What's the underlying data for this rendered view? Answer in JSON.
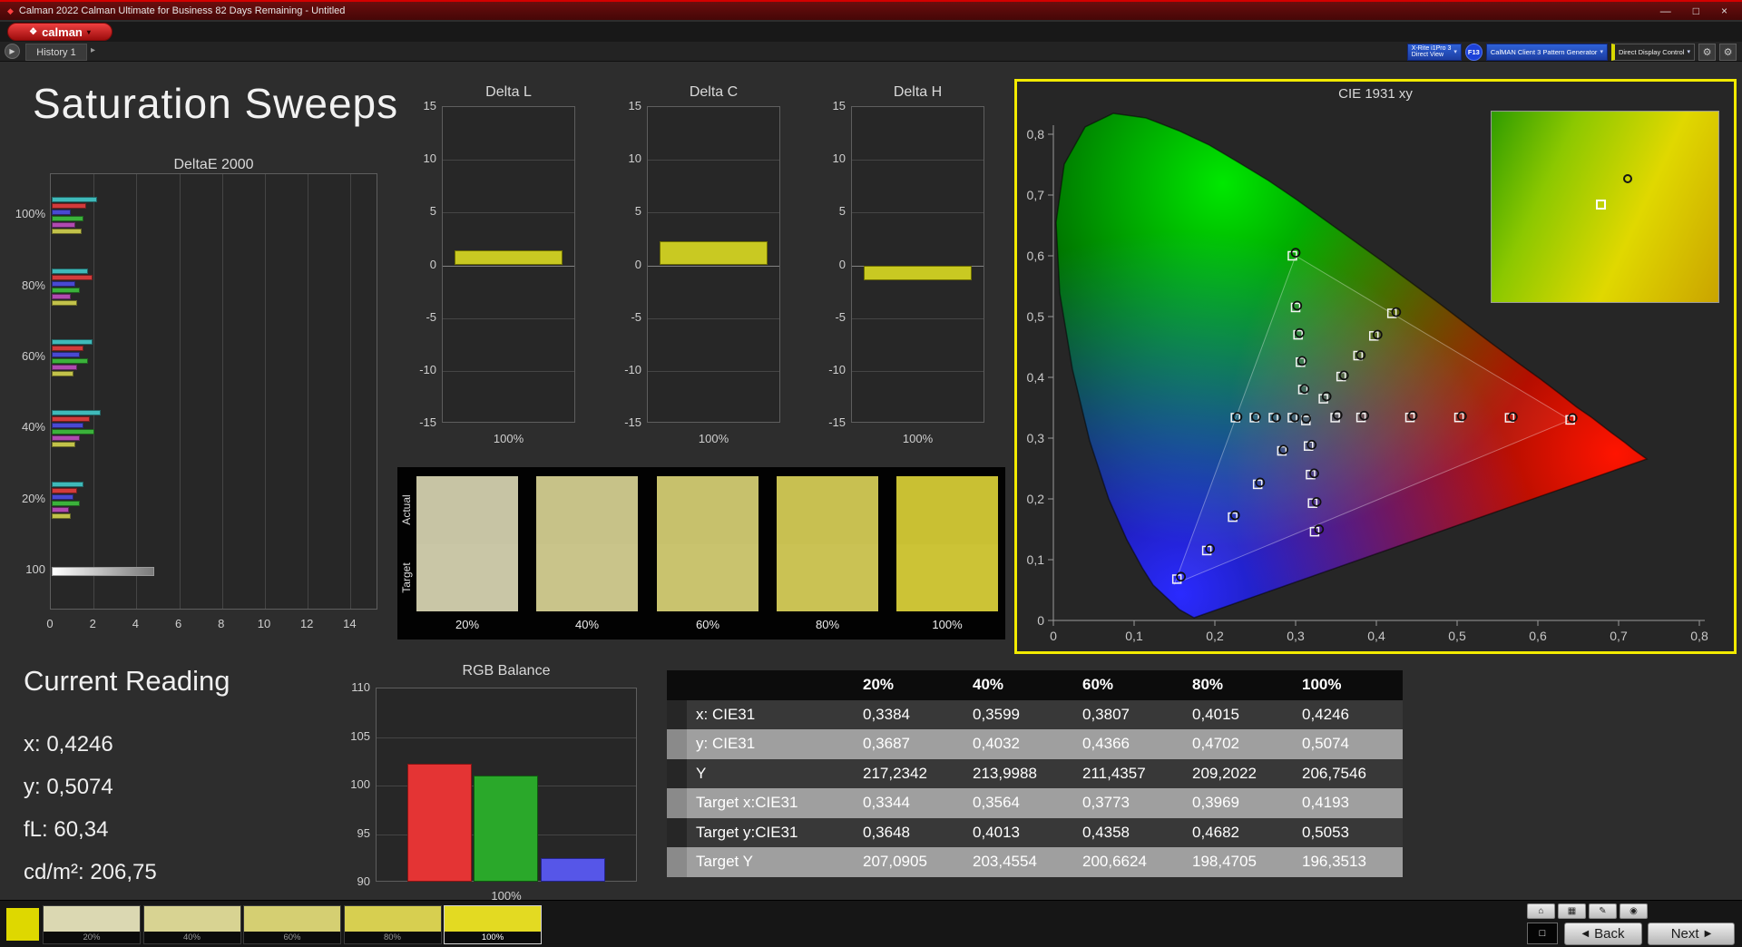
{
  "window": {
    "title": "Calman 2022 Calman Ultimate for Business 82 Days Remaining  - Untitled"
  },
  "icons": {
    "app": "◆",
    "logo_mark": "❖",
    "caret_down": "▾",
    "minimize": "—",
    "maximize": "□",
    "close": "×",
    "play": "▶",
    "chevron_right": "▸",
    "gear": "⚙",
    "back_arrow": "◀",
    "next_arrow": "▶",
    "home": "⌂",
    "grid": "▦",
    "edit": "✎",
    "dot": "◉",
    "square_outline": "□"
  },
  "brand": {
    "logo_text": "calman"
  },
  "tabs": {
    "history": "History 1"
  },
  "devices": {
    "meter_line1": "X-Rite i1Pro 3",
    "meter_line2": "Direct View",
    "meter_badge": "F13",
    "pattern_generator": "CalMAN Client 3 Pattern Generator",
    "display_control": "Direct Display Control"
  },
  "page": {
    "title": "Saturation Sweeps"
  },
  "current_reading": {
    "title": "Current Reading",
    "x": "x: 0,4246",
    "y": "y: 0,5074",
    "fl": "fL: 60,34",
    "cdm2": "cd/m²: 206,75"
  },
  "color_compare": {
    "row_labels": [
      "Actual",
      "Target"
    ],
    "columns": [
      {
        "label": "20%",
        "actual": "#c7c4a4",
        "target": "#c9c6a6"
      },
      {
        "label": "40%",
        "actual": "#c7c288",
        "target": "#c9c48a"
      },
      {
        "label": "60%",
        "actual": "#c7c16c",
        "target": "#c9c36e"
      },
      {
        "label": "80%",
        "actual": "#c8c051",
        "target": "#cac254"
      },
      {
        "label": "100%",
        "actual": "#c9c033",
        "target": "#ccc336"
      }
    ]
  },
  "table": {
    "headers": [
      "",
      "20%",
      "40%",
      "60%",
      "80%",
      "100%"
    ],
    "rows": [
      {
        "label": "x: CIE31",
        "values": [
          "0,3384",
          "0,3599",
          "0,3807",
          "0,4015",
          "0,4246"
        ]
      },
      {
        "label": "y: CIE31",
        "values": [
          "0,3687",
          "0,4032",
          "0,4366",
          "0,4702",
          "0,5074"
        ]
      },
      {
        "label": "Y",
        "values": [
          "217,2342",
          "213,9988",
          "211,4357",
          "209,2022",
          "206,7546"
        ]
      },
      {
        "label": "Target x:CIE31",
        "values": [
          "0,3344",
          "0,3564",
          "0,3773",
          "0,3969",
          "0,4193"
        ]
      },
      {
        "label": "Target y:CIE31",
        "values": [
          "0,3648",
          "0,4013",
          "0,4358",
          "0,4682",
          "0,5053"
        ]
      },
      {
        "label": "Target Y",
        "values": [
          "207,0905",
          "203,4554",
          "200,6624",
          "198,4705",
          "196,3513"
        ]
      }
    ]
  },
  "footer": {
    "back_label": "Back",
    "next_label": "Next",
    "swatches": [
      {
        "label": "20%",
        "color": "#dbd8b2",
        "selected": false
      },
      {
        "label": "40%",
        "color": "#d8d392",
        "selected": false
      },
      {
        "label": "60%",
        "color": "#d5cf72",
        "selected": false
      },
      {
        "label": "80%",
        "color": "#d7cf50",
        "selected": false
      },
      {
        "label": "100%",
        "color": "#e3da22",
        "selected": true
      }
    ]
  },
  "chart_data": [
    {
      "id": "deltae_2000",
      "type": "bar",
      "orientation": "horizontal",
      "title": "DeltaE 2000",
      "group_labels": [
        "100%",
        "80%",
        "60%",
        "40%",
        "20%"
      ],
      "series_colors": [
        "#3fb9b9",
        "#d23b3b",
        "#4949d2",
        "#3bb23b",
        "#b04ab0",
        "#c2c24a"
      ],
      "groups": [
        [
          2.1,
          1.6,
          0.9,
          1.5,
          1.1,
          1.4
        ],
        [
          1.7,
          1.9,
          1.1,
          1.3,
          0.9,
          1.2
        ],
        [
          1.9,
          1.5,
          1.3,
          1.7,
          1.2,
          1.0
        ],
        [
          2.3,
          1.8,
          1.5,
          2.0,
          1.3,
          1.1
        ],
        [
          1.5,
          1.2,
          1.0,
          1.3,
          0.8,
          0.9
        ]
      ],
      "luminance_row": {
        "label": "100",
        "value": 4.8
      },
      "xlim": [
        0,
        15
      ],
      "xticks": [
        0,
        2,
        4,
        6,
        8,
        10,
        12,
        14
      ]
    },
    {
      "id": "delta_l",
      "type": "bar",
      "title": "Delta L",
      "categories": [
        "100%"
      ],
      "values": [
        1.4
      ],
      "ylim": [
        -15,
        15
      ],
      "yticks": [
        15,
        10,
        5,
        0,
        -5,
        -10,
        -15
      ],
      "xlabel": "100%",
      "bar_color": "#c9c922"
    },
    {
      "id": "delta_c",
      "type": "bar",
      "title": "Delta C",
      "categories": [
        "100%"
      ],
      "values": [
        2.3
      ],
      "ylim": [
        -15,
        15
      ],
      "yticks": [
        15,
        10,
        5,
        0,
        -5,
        -10,
        -15
      ],
      "xlabel": "100%",
      "bar_color": "#c9c922"
    },
    {
      "id": "delta_h",
      "type": "bar",
      "title": "Delta H",
      "categories": [
        "100%"
      ],
      "values": [
        -1.4
      ],
      "ylim": [
        -15,
        15
      ],
      "yticks": [
        15,
        10,
        5,
        0,
        -5,
        -10,
        -15
      ],
      "xlabel": "100%",
      "bar_color": "#c9c922"
    },
    {
      "id": "rgb_balance",
      "type": "bar",
      "title": "RGB Balance",
      "categories": [
        "Red",
        "Green",
        "Blue"
      ],
      "values": [
        102.2,
        101.0,
        92.5
      ],
      "colors": [
        "#e43434",
        "#2aa82a",
        "#5656e8"
      ],
      "border_colors": [
        "#8a1515",
        "#0f5a0f",
        "#24248a"
      ],
      "ylim": [
        90,
        110
      ],
      "yticks": [
        110,
        105,
        100,
        95,
        90
      ],
      "xlabel": "100%"
    },
    {
      "id": "cie_1931",
      "type": "scatter",
      "title": "CIE 1931 xy",
      "xlim": [
        0,
        0.8
      ],
      "ylim": [
        0,
        0.88
      ],
      "xtick_labels": [
        "0",
        "0,1",
        "0,2",
        "0,3",
        "0,4",
        "0,5",
        "0,6",
        "0,7",
        "0,8"
      ],
      "ytick_labels": [
        "0",
        "0,1",
        "0,2",
        "0,3",
        "0,4",
        "0,5",
        "0,6",
        "0,7",
        "0,8"
      ],
      "gamut_triangle": {
        "red": [
          0.64,
          0.33
        ],
        "green": [
          0.3,
          0.6
        ],
        "blue": [
          0.15,
          0.06
        ]
      },
      "targets": [
        [
          0.2255,
          0.3337
        ],
        [
          0.249,
          0.3337
        ],
        [
          0.2725,
          0.3337
        ],
        [
          0.296,
          0.3337
        ],
        [
          0.3127,
          0.329
        ],
        [
          0.349,
          0.3337
        ],
        [
          0.381,
          0.334
        ],
        [
          0.4416,
          0.334
        ],
        [
          0.5023,
          0.334
        ],
        [
          0.565,
          0.3335
        ],
        [
          0.64,
          0.33
        ],
        [
          0.309,
          0.38
        ],
        [
          0.306,
          0.425
        ],
        [
          0.303,
          0.47
        ],
        [
          0.3,
          0.515
        ],
        [
          0.296,
          0.6
        ],
        [
          0.3344,
          0.3648
        ],
        [
          0.3564,
          0.4013
        ],
        [
          0.3773,
          0.4358
        ],
        [
          0.3969,
          0.4682
        ],
        [
          0.4193,
          0.5053
        ],
        [
          0.283,
          0.279
        ],
        [
          0.253,
          0.224
        ],
        [
          0.222,
          0.17
        ],
        [
          0.19,
          0.115
        ],
        [
          0.153,
          0.068
        ],
        [
          0.316,
          0.287
        ],
        [
          0.3185,
          0.24
        ],
        [
          0.321,
          0.193
        ],
        [
          0.3235,
          0.146
        ]
      ],
      "measurements": [
        [
          0.3131,
          0.3323
        ],
        [
          0.352,
          0.338
        ],
        [
          0.385,
          0.337
        ],
        [
          0.445,
          0.337
        ],
        [
          0.506,
          0.336
        ],
        [
          0.569,
          0.335
        ],
        [
          0.643,
          0.333
        ],
        [
          0.228,
          0.335
        ],
        [
          0.251,
          0.335
        ],
        [
          0.276,
          0.334
        ],
        [
          0.299,
          0.334
        ],
        [
          0.311,
          0.381
        ],
        [
          0.308,
          0.427
        ],
        [
          0.305,
          0.473
        ],
        [
          0.302,
          0.518
        ],
        [
          0.3,
          0.605
        ],
        [
          0.3384,
          0.3687
        ],
        [
          0.3599,
          0.4032
        ],
        [
          0.3807,
          0.4366
        ],
        [
          0.4015,
          0.4702
        ],
        [
          0.4246,
          0.5074
        ],
        [
          0.285,
          0.281
        ],
        [
          0.256,
          0.227
        ],
        [
          0.225,
          0.173
        ],
        [
          0.194,
          0.118
        ],
        [
          0.158,
          0.072
        ],
        [
          0.32,
          0.289
        ],
        [
          0.323,
          0.242
        ],
        [
          0.326,
          0.195
        ],
        [
          0.329,
          0.15
        ]
      ]
    }
  ]
}
